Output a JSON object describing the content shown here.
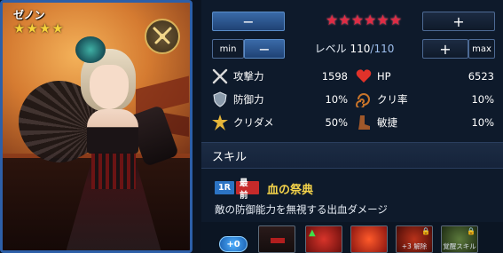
{
  "card": {
    "name": "ゼノン",
    "stars": [
      "★",
      "★",
      "★",
      "★"
    ],
    "class_icon": "crossed-swords-emblem-icon"
  },
  "rarity": {
    "minus_label": "−",
    "plus_label": "+",
    "stars": [
      "★",
      "★",
      "★",
      "★",
      "★",
      "★"
    ],
    "star_color": "#e02b44"
  },
  "level": {
    "min_label": "min",
    "minus_label": "−",
    "plus_label": "+",
    "max_label": "max",
    "prefix": "レベル ",
    "current": "110",
    "separator": "/",
    "maximum": "110"
  },
  "stats": {
    "attack": {
      "label": "攻撃力",
      "value": "1598",
      "icon": "crossed-swords-icon"
    },
    "hp": {
      "label": "HP",
      "value": "6523",
      "icon": "heart-icon"
    },
    "defense": {
      "label": "防御力",
      "value": "10%",
      "icon": "shield-icon"
    },
    "crit_rate": {
      "label": "クリ率",
      "value": "10%",
      "icon": "swirl-icon"
    },
    "crit_damage": {
      "label": "クリダメ",
      "value": "50%",
      "icon": "burst-icon"
    },
    "agility": {
      "label": "敏捷",
      "value": "10%",
      "icon": "boot-icon"
    }
  },
  "skill": {
    "section_title": "スキル",
    "tag_round": "1R",
    "tag_position": "最前",
    "name": "血の祭典",
    "description": "敵の防御能力を無視する出血ダメージ"
  },
  "enhancements": {
    "plus_badge": "+0",
    "slots": [
      {
        "icon": "blood-slot-icon",
        "caption": ""
      },
      {
        "icon": "fangs-icon",
        "caption": ""
      },
      {
        "icon": "burst-skill-icon",
        "caption": ""
      },
      {
        "icon": "locked-skill-icon",
        "caption": "+3 解除",
        "lock": "🔒"
      },
      {
        "icon": "locked-skill-icon",
        "caption": "覚醒スキル",
        "lock": "🔒"
      }
    ]
  },
  "colors": {
    "accent_blue": "#2d5fa8",
    "gold": "#f4d34a",
    "tag_blue": "#2c74c4",
    "tag_red": "#c62a2a"
  }
}
